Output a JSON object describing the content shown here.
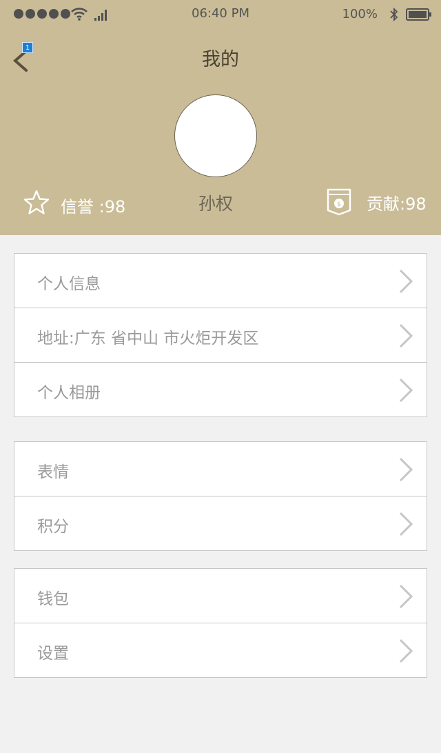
{
  "status_bar": {
    "time": "06:40 PM",
    "battery": "100%",
    "icons": [
      "signal-dots-icon",
      "wifi-icon",
      "cellular-icon",
      "bluetooth-icon",
      "battery-icon"
    ]
  },
  "nav": {
    "title": "我的",
    "badge_count": "1",
    "back_icon": "chevron-left-icon"
  },
  "profile": {
    "name": "孙权",
    "credit": "信誉 :98",
    "contribution": "贡献:98"
  },
  "groups": [
    {
      "items": [
        {
          "label": "个人信息"
        },
        {
          "label": "地址:广东 省中山 市火炬开发区"
        },
        {
          "label": "个人相册"
        }
      ]
    },
    {
      "items": [
        {
          "label": "表情"
        },
        {
          "label": "积分"
        }
      ]
    },
    {
      "items": [
        {
          "label": "钱包"
        },
        {
          "label": "设置"
        }
      ]
    }
  ],
  "colors": {
    "header_bg": "#c9bc96",
    "page_bg": "#f1f1f1",
    "badge_blue": "#1e7fd0"
  }
}
